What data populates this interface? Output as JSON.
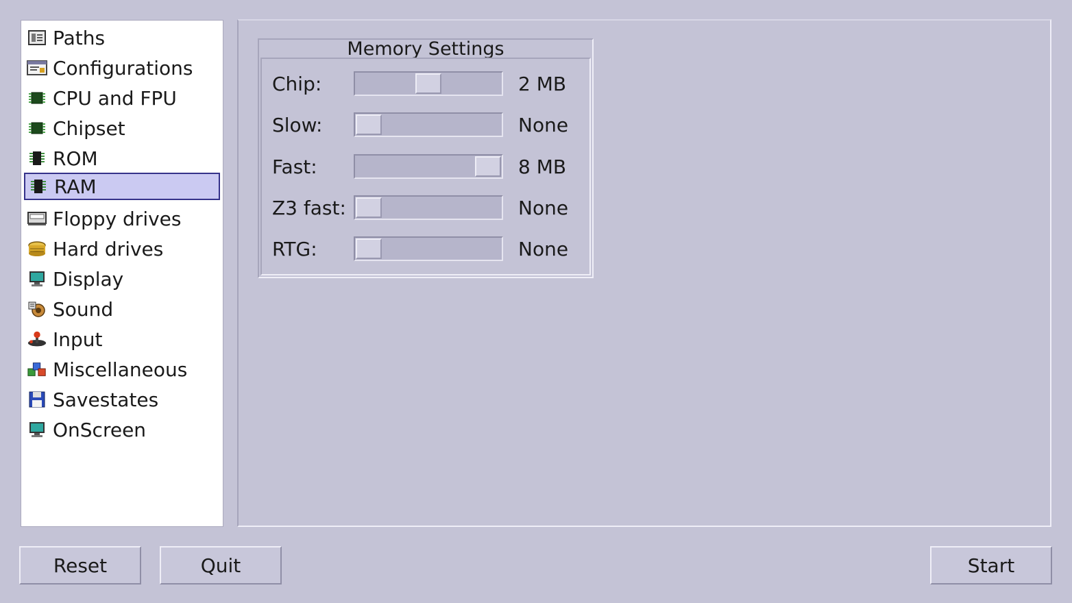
{
  "sidebar": {
    "items": [
      {
        "label": "Paths",
        "icon": "paths-icon"
      },
      {
        "label": "Configurations",
        "icon": "configurations-icon"
      },
      {
        "label": "CPU and FPU",
        "icon": "cpu-chip-icon"
      },
      {
        "label": "Chipset",
        "icon": "chipset-chip-icon"
      },
      {
        "label": "ROM",
        "icon": "rom-chip-icon"
      },
      {
        "label": "RAM",
        "icon": "ram-chip-icon",
        "selected": true
      },
      {
        "label": "Floppy drives",
        "icon": "floppy-drive-icon"
      },
      {
        "label": "Hard drives",
        "icon": "hard-drive-icon"
      },
      {
        "label": "Display",
        "icon": "monitor-icon"
      },
      {
        "label": "Sound",
        "icon": "sound-icon"
      },
      {
        "label": "Input",
        "icon": "joystick-icon"
      },
      {
        "label": "Miscellaneous",
        "icon": "miscellaneous-icon"
      },
      {
        "label": "Savestates",
        "icon": "save-disk-icon"
      },
      {
        "label": "OnScreen",
        "icon": "onscreen-monitor-icon"
      }
    ]
  },
  "memory": {
    "title": "Memory Settings",
    "rows": [
      {
        "label": "Chip:",
        "value": "2 MB",
        "level": 0.5
      },
      {
        "label": "Slow:",
        "value": "None",
        "level": 0.0
      },
      {
        "label": "Fast:",
        "value": "8 MB",
        "level": 1.0
      },
      {
        "label": "Z3 fast:",
        "value": "None",
        "level": 0.0
      },
      {
        "label": "RTG:",
        "value": "None",
        "level": 0.0
      }
    ]
  },
  "buttons": {
    "reset": "Reset",
    "quit": "Quit",
    "start": "Start"
  },
  "colors": {
    "background": "#c4c3d6",
    "selection_fill": "#cbcaf2",
    "selection_border": "#35328a"
  }
}
